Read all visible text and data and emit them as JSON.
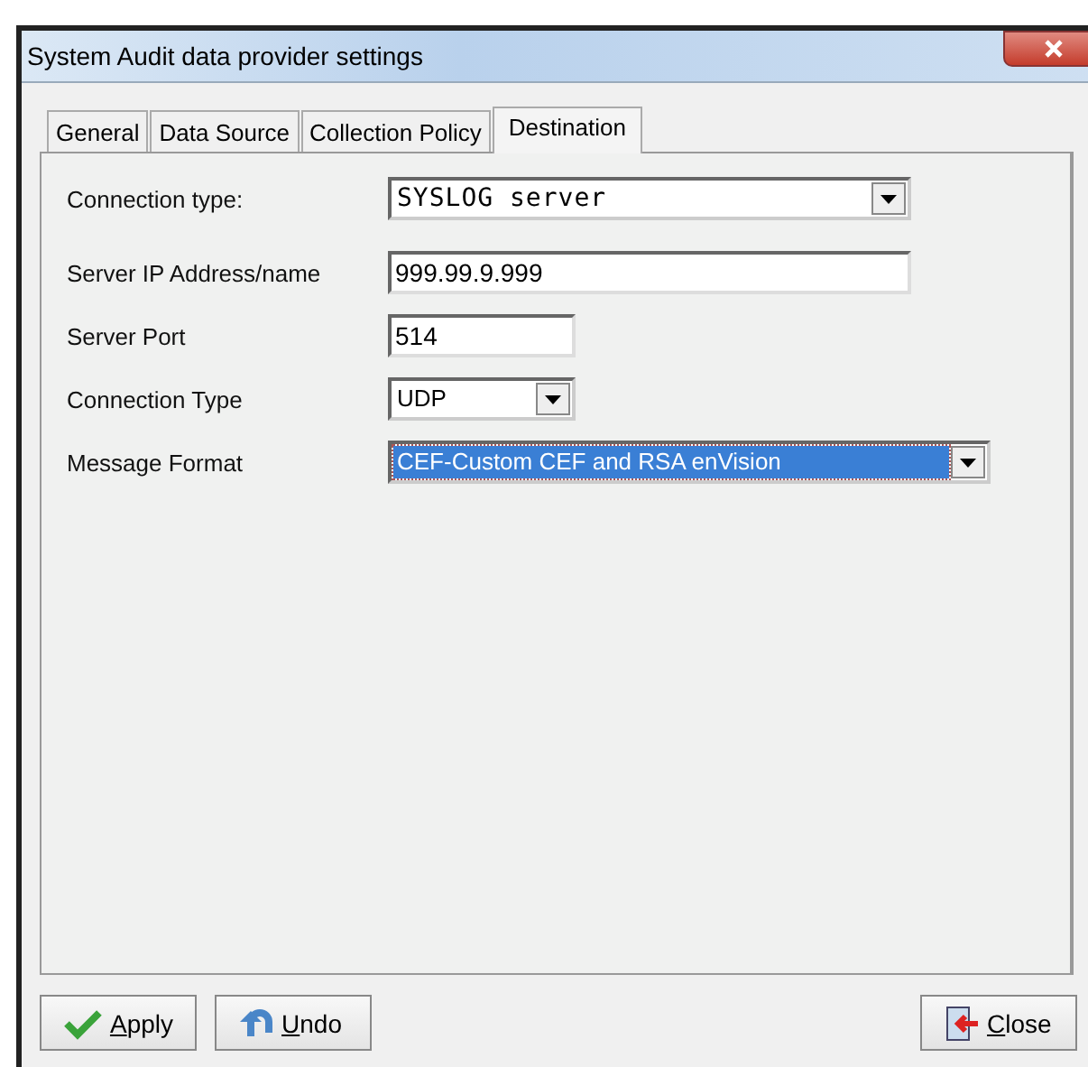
{
  "window": {
    "title": "System Audit data provider settings"
  },
  "tabs": [
    {
      "label": "General",
      "selected": false
    },
    {
      "label": "Data Source",
      "selected": false
    },
    {
      "label": "Collection Policy",
      "selected": false
    },
    {
      "label": "Destination",
      "selected": true
    }
  ],
  "fields": [
    {
      "label": "Connection type:",
      "kind": "dropdown",
      "value": "SYSLOG server",
      "highlighted": false
    },
    {
      "label": "Server IP Address/name",
      "kind": "text",
      "value": "999.99.9.999",
      "highlighted": false
    },
    {
      "label": "Server Port",
      "kind": "text",
      "value": "514",
      "highlighted": false
    },
    {
      "label": "Connection Type",
      "kind": "dropdown",
      "value": "UDP",
      "highlighted": false
    },
    {
      "label": "Message Format",
      "kind": "dropdown",
      "value": "CEF-Custom CEF and RSA enVision",
      "highlighted": true
    }
  ],
  "buttons": [
    {
      "label": "Apply",
      "kind": "apply"
    },
    {
      "label": "Undo",
      "kind": "undo"
    },
    {
      "label": "Close",
      "kind": "close"
    }
  ]
}
